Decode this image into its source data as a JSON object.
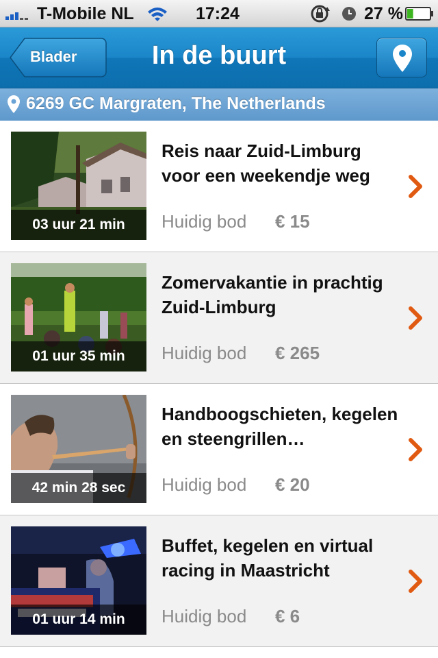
{
  "status_bar": {
    "carrier": "T-Mobile NL",
    "time": "17:24",
    "battery": "27 %",
    "battery_level": 0.27
  },
  "nav": {
    "back_label": "Blader",
    "title": "In de buurt"
  },
  "location": {
    "text": "6269 GC Margraten, The Netherlands"
  },
  "colors": {
    "nav_blue": "#1a86c9",
    "chevron_orange": "#e05a12"
  },
  "listings": [
    {
      "title": "Reis naar Zuid-Limburg voor een weekendje weg",
      "timer": "03 uur 21 min",
      "bid_label": "Huidig bod",
      "bid_value": "€ 15"
    },
    {
      "title": "Zomervakantie in prachtig Zuid-Limburg",
      "timer": "01 uur 35 min",
      "bid_label": "Huidig bod",
      "bid_value": "€ 265"
    },
    {
      "title": "Handboogschieten, kegelen en steengrillen…",
      "timer": "42 min 28 sec",
      "bid_label": "Huidig bod",
      "bid_value": "€ 20"
    },
    {
      "title": "Buffet, kegelen en virtual racing in Maastricht",
      "timer": "01 uur 14 min",
      "bid_label": "Huidig bod",
      "bid_value": "€ 6"
    }
  ]
}
